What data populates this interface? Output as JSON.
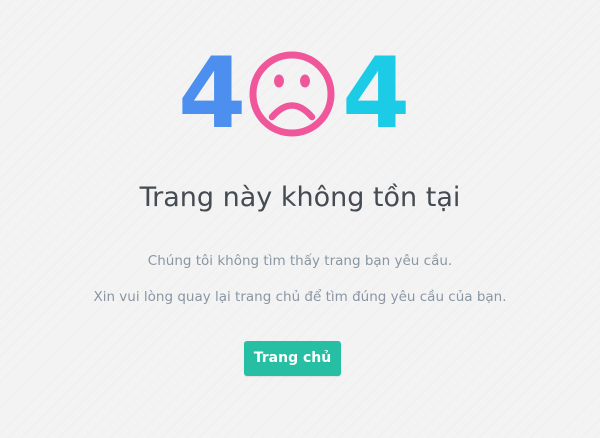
{
  "error": {
    "digit_left": "4",
    "digit_right": "4",
    "face_icon": "sad-face-icon",
    "colors": {
      "digit_left": "#4d8fef",
      "face": "#f0579b",
      "digit_right": "#1ccbe6"
    }
  },
  "title": "Trang này không tồn tại",
  "messages": [
    "Chúng tôi không tìm thấy trang bạn yêu cầu.",
    "Xin vui lòng quay lại trang chủ để tìm đúng yêu cầu của bạn."
  ],
  "home_button": {
    "label": "Trang chủ",
    "color": "#26bfa4"
  }
}
